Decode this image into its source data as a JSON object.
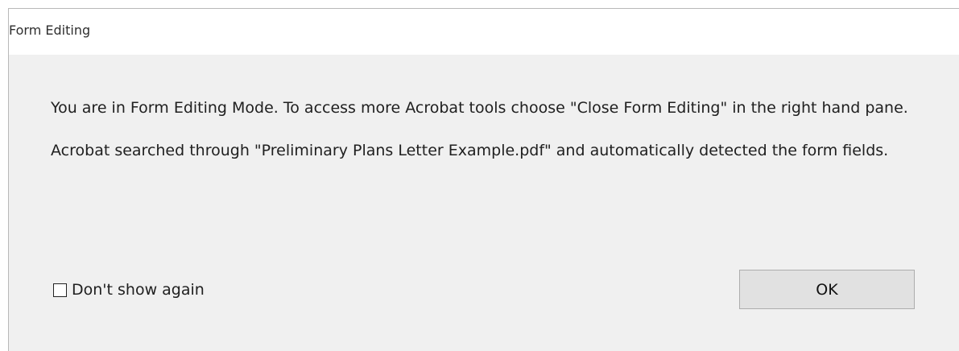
{
  "dialog": {
    "title": "Form Editing",
    "messages": [
      "You are in Form Editing Mode. To access more Acrobat tools choose \"Close Form Editing\" in the right hand pane.",
      "Acrobat searched through \"Preliminary Plans Letter Example.pdf\" and automatically detected the form fields."
    ],
    "checkbox_label": "Don't show again",
    "ok_label": "OK",
    "checkbox_checked": false
  }
}
